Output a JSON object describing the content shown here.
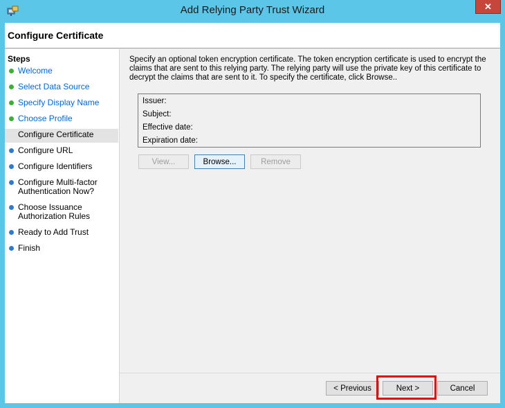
{
  "window": {
    "title": "Add Relying Party Trust Wizard",
    "close_label": "✕",
    "colors": {
      "frame": "#5bc6e8",
      "close": "#c7463c",
      "highlight": "#e00000"
    }
  },
  "page": {
    "title": "Configure Certificate"
  },
  "steps": {
    "heading": "Steps",
    "items": [
      {
        "label": "Welcome",
        "state": "done"
      },
      {
        "label": "Select Data Source",
        "state": "done"
      },
      {
        "label": "Specify Display Name",
        "state": "done"
      },
      {
        "label": "Choose Profile",
        "state": "done"
      },
      {
        "label": "Configure Certificate",
        "state": "current"
      },
      {
        "label": "Configure URL",
        "state": "todo"
      },
      {
        "label": "Configure Identifiers",
        "state": "todo"
      },
      {
        "label": "Configure Multi-factor Authentication Now?",
        "state": "todo"
      },
      {
        "label": "Choose Issuance Authorization Rules",
        "state": "todo"
      },
      {
        "label": "Ready to Add Trust",
        "state": "todo"
      },
      {
        "label": "Finish",
        "state": "todo"
      }
    ]
  },
  "content": {
    "description": "Specify an optional token encryption certificate.  The token encryption certificate is used to encrypt the claims that are sent to this relying party.  The relying party will use the private key of this certificate to decrypt the claims that are sent to it.  To specify the certificate, click Browse..",
    "cert_fields": {
      "issuer": "Issuer:",
      "subject": "Subject:",
      "effective": "Effective date:",
      "expiration": "Expiration date:"
    },
    "view_label": "View...",
    "browse_label": "Browse...",
    "remove_label": "Remove"
  },
  "footer": {
    "previous_label": "< Previous",
    "next_label": "Next >",
    "cancel_label": "Cancel"
  }
}
